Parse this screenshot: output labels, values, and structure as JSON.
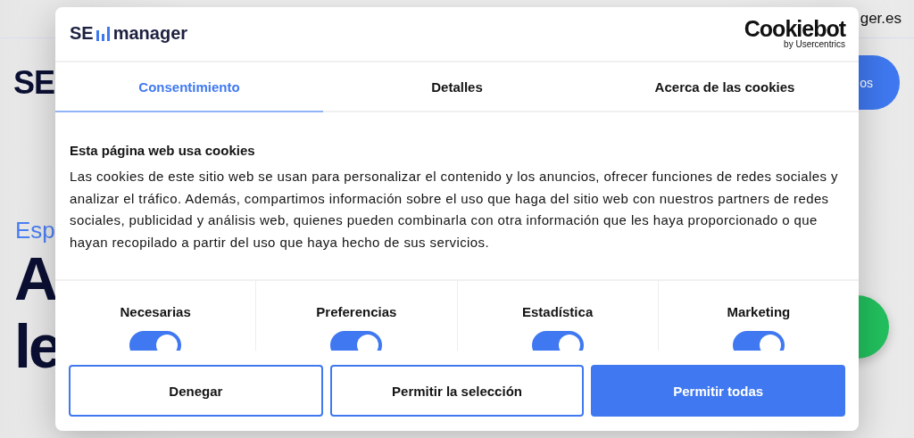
{
  "background_page": {
    "logo": "SE",
    "top_link": "ger.es",
    "header_button": "os",
    "eyebrow": "Esp",
    "headline": [
      "A",
      "le"
    ]
  },
  "dialog": {
    "logo": {
      "left": "SE",
      "right": "manager"
    },
    "provider": {
      "name": "Cookiebot",
      "byline": "by Usercentrics"
    },
    "tabs": [
      {
        "label": "Consentimiento",
        "selected": true
      },
      {
        "label": "Detalles",
        "selected": false
      },
      {
        "label": "Acerca de las cookies",
        "selected": false
      }
    ],
    "heading": "Esta página web usa cookies",
    "body": "Las cookies de este sitio web se usan para personalizar el contenido y los anuncios, ofrecer funciones de redes sociales y analizar el tráfico. Además, compartimos información sobre el uso que haga del sitio web con nuestros partners de redes sociales, publicidad y análisis web, quienes pueden combinarla con otra información que les haya proporcionado o que hayan recopilado a partir del uso que haya hecho de sus servicios.",
    "categories": [
      {
        "label": "Necesarias",
        "checked": true
      },
      {
        "label": "Preferencias",
        "checked": true
      },
      {
        "label": "Estadística",
        "checked": true
      },
      {
        "label": "Marketing",
        "checked": true
      }
    ],
    "buttons": [
      {
        "label": "Denegar",
        "kind": "outline"
      },
      {
        "label": "Permitir la selección",
        "kind": "outline"
      },
      {
        "label": "Permitir todas",
        "kind": "filled"
      }
    ]
  }
}
